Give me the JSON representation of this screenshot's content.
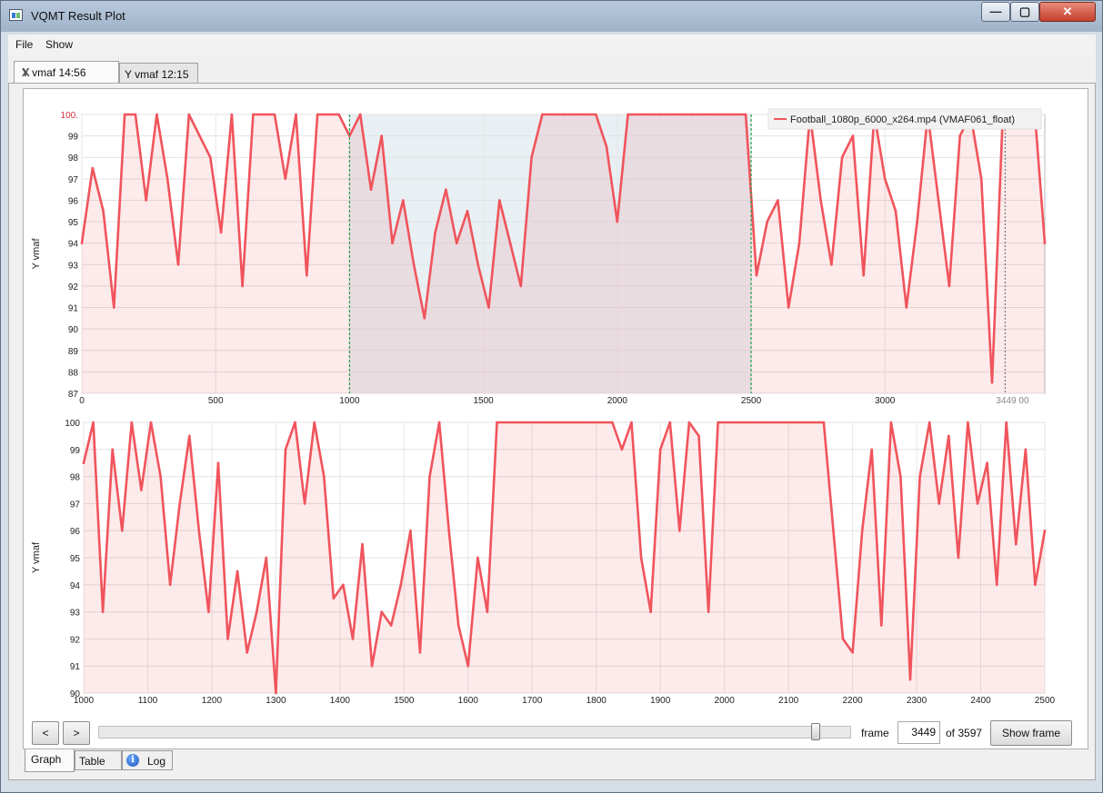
{
  "window": {
    "title": "VQMT Result Plot",
    "min_glyph": "—",
    "max_glyph": "▢",
    "close_glyph": "✕"
  },
  "menu": {
    "items": [
      "File",
      "Show"
    ]
  },
  "tabs": [
    {
      "label": "Y vmaf 14:56",
      "close": "X"
    },
    {
      "label": "Y vmaf 12:15"
    }
  ],
  "chart_data": [
    {
      "type": "line",
      "name": "overview",
      "ylabel": "Y vmaf",
      "ylim": [
        87,
        100
      ],
      "xlim": [
        0,
        3597
      ],
      "yticks": [
        "87",
        "88",
        "89",
        "90",
        "91",
        "92",
        "93",
        "94",
        "95",
        "96",
        "97",
        "98",
        "99",
        "100."
      ],
      "xticks": [
        "0",
        "500",
        "1000",
        "1500",
        "2000",
        "2500",
        "3000"
      ],
      "x_values": [
        0,
        500,
        1000,
        1500,
        2000,
        2500,
        3000
      ],
      "cursor_label": "3449",
      "cursor_frame": 3449,
      "end_label": "00",
      "selection": [
        1000,
        2500
      ],
      "legend": "Football_1080p_6000_x264.mp4 (VMAF061_float)",
      "series_color": "#f0545c",
      "points_x": [
        0,
        40,
        80,
        120,
        160,
        200,
        240,
        280,
        320,
        360,
        400,
        440,
        480,
        520,
        560,
        600,
        640,
        680,
        720,
        760,
        800,
        840,
        880,
        920,
        960,
        1000,
        1040,
        1080,
        1120,
        1160,
        1200,
        1240,
        1280,
        1320,
        1360,
        1400,
        1440,
        1480,
        1520,
        1560,
        1600,
        1640,
        1680,
        1720,
        1760,
        1800,
        1840,
        1880,
        1920,
        1960,
        2000,
        2040,
        2080,
        2120,
        2160,
        2200,
        2240,
        2280,
        2320,
        2360,
        2400,
        2440,
        2480,
        2520,
        2560,
        2600,
        2640,
        2680,
        2720,
        2760,
        2800,
        2840,
        2880,
        2920,
        2960,
        3000,
        3040,
        3080,
        3120,
        3160,
        3200,
        3240,
        3280,
        3320,
        3360,
        3400,
        3440,
        3480,
        3520,
        3560,
        3597
      ],
      "points_y": [
        94.0,
        97.5,
        95.5,
        91.0,
        100,
        100,
        96.0,
        100,
        97.0,
        93.0,
        100,
        99.0,
        98.0,
        94.5,
        100,
        92.0,
        100,
        100,
        100,
        97.0,
        100,
        92.5,
        100,
        100,
        100,
        99.0,
        100,
        96.5,
        99.0,
        94.0,
        96.0,
        93.0,
        90.5,
        94.5,
        96.5,
        94.0,
        95.5,
        93.0,
        91.0,
        96.0,
        94.0,
        92.0,
        98.0,
        100,
        100,
        100,
        100,
        100,
        100,
        98.5,
        95.0,
        100,
        100,
        100,
        100,
        100,
        100,
        100,
        100,
        100,
        100,
        100,
        100,
        92.5,
        95.0,
        96.0,
        91.0,
        94.0,
        100,
        96.0,
        93.0,
        98.0,
        99.0,
        92.5,
        100,
        97.0,
        95.5,
        91.0,
        95.0,
        100,
        96.0,
        92.0,
        99.0,
        100,
        97.0,
        87.5,
        100,
        99.5,
        100,
        100,
        94.0
      ]
    },
    {
      "type": "line",
      "name": "zoom",
      "ylabel": "Y vmaf",
      "ylim": [
        90,
        100
      ],
      "xlim": [
        1000,
        2500
      ],
      "yticks": [
        "90",
        "91",
        "92",
        "93",
        "94",
        "95",
        "96",
        "97",
        "98",
        "99",
        "100"
      ],
      "xticks": [
        "1000",
        "1100",
        "1200",
        "1300",
        "1400",
        "1500",
        "1600",
        "1700",
        "1800",
        "1900",
        "2000",
        "2100",
        "2200",
        "2300",
        "2400",
        "2500"
      ],
      "series_color": "#f0545c",
      "points_x": [
        1000,
        1015,
        1030,
        1045,
        1060,
        1075,
        1090,
        1105,
        1120,
        1135,
        1150,
        1165,
        1180,
        1195,
        1210,
        1225,
        1240,
        1255,
        1270,
        1285,
        1300,
        1315,
        1330,
        1345,
        1360,
        1375,
        1390,
        1405,
        1420,
        1435,
        1450,
        1465,
        1480,
        1495,
        1510,
        1525,
        1540,
        1555,
        1570,
        1585,
        1600,
        1615,
        1630,
        1645,
        1660,
        1675,
        1690,
        1705,
        1720,
        1735,
        1750,
        1765,
        1780,
        1795,
        1810,
        1825,
        1840,
        1855,
        1870,
        1885,
        1900,
        1915,
        1930,
        1945,
        1960,
        1975,
        1990,
        2005,
        2020,
        2035,
        2050,
        2065,
        2080,
        2095,
        2110,
        2125,
        2140,
        2155,
        2170,
        2185,
        2200,
        2215,
        2230,
        2245,
        2260,
        2275,
        2290,
        2305,
        2320,
        2335,
        2350,
        2365,
        2380,
        2395,
        2410,
        2425,
        2440,
        2455,
        2470,
        2485,
        2500
      ],
      "points_y": [
        98.5,
        100,
        93.0,
        99.0,
        96.0,
        100,
        97.5,
        100,
        98.0,
        94.0,
        97.0,
        99.5,
        96.0,
        93.0,
        98.5,
        92.0,
        94.5,
        91.5,
        93.0,
        95.0,
        90.0,
        99.0,
        100,
        97.0,
        100,
        98.0,
        93.5,
        94.0,
        92.0,
        95.5,
        91.0,
        93.0,
        92.5,
        94.0,
        96.0,
        91.5,
        98.0,
        100,
        96.0,
        92.5,
        91.0,
        95.0,
        93.0,
        100,
        100,
        100,
        100,
        100,
        100,
        100,
        100,
        100,
        100,
        100,
        100,
        100,
        99.0,
        100,
        95.0,
        93.0,
        99.0,
        100,
        96.0,
        100,
        99.5,
        93.0,
        100,
        100,
        100,
        100,
        100,
        100,
        100,
        100,
        100,
        100,
        100,
        100,
        96.0,
        92.0,
        91.5,
        96.0,
        99.0,
        92.5,
        100,
        98.0,
        90.5,
        98.0,
        100,
        97.0,
        99.5,
        95.0,
        100,
        97.0,
        98.5,
        94.0,
        100,
        95.5,
        99.0,
        94.0,
        96.0
      ]
    }
  ],
  "controls": {
    "prev": "<",
    "next": ">",
    "frame_label": "frame",
    "frame_value": "3449",
    "of_label": "of 3597",
    "frame_total": 3597,
    "show_frame": "Show frame"
  },
  "bottom_tabs": [
    "Graph",
    "Table",
    "Log"
  ],
  "info_glyph": "i"
}
